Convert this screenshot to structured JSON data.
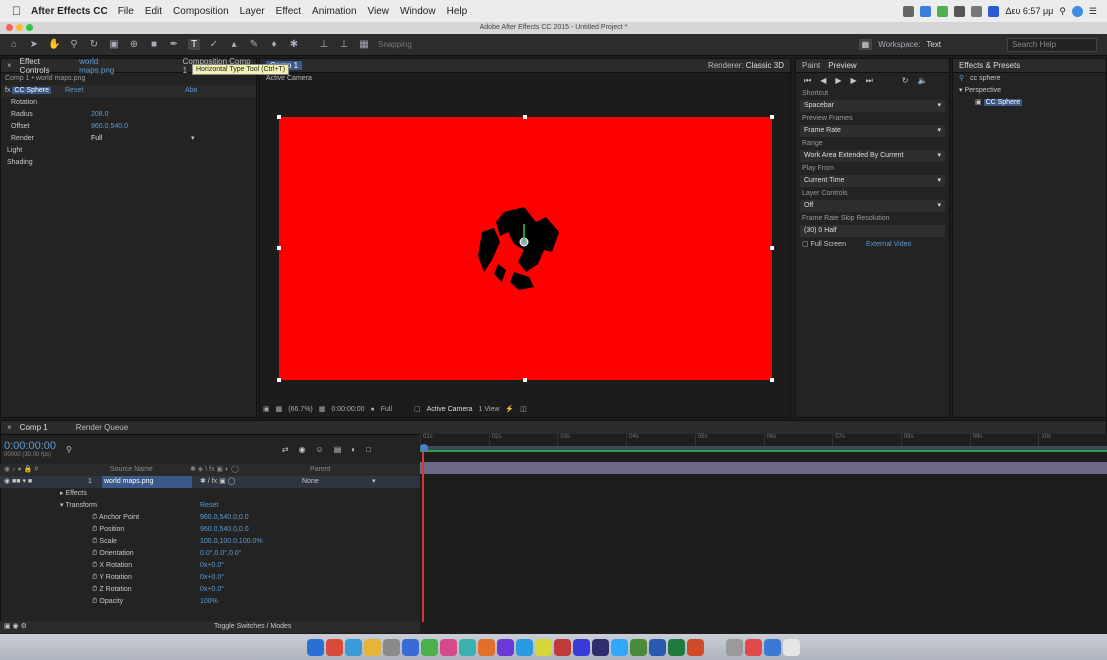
{
  "menubar": {
    "app_name": "After Effects CC",
    "items": [
      "File",
      "Edit",
      "Composition",
      "Layer",
      "Effect",
      "Animation",
      "View",
      "Window",
      "Help"
    ],
    "clock": "Δευ 6:57 μμ"
  },
  "window_title": "Adobe After Effects CC 2015 - Untitled Project *",
  "toolbar": {
    "snapping": "Snapping",
    "workspace_label": "Workspace:",
    "workspace_value": "Text",
    "search_placeholder": "Search Help"
  },
  "tooltip": "Horizontal Type Tool (Ctrl+T)",
  "effect_controls": {
    "tab": "Effect Controls",
    "tab_file": "world maps.png",
    "tab_comp": "Composition Comp 1",
    "header": "Comp 1 • world maps.png",
    "effect_name": "CC Sphere",
    "reset": "Reset",
    "about": "Abo",
    "rows": [
      {
        "name": "Rotation",
        "value": ""
      },
      {
        "name": "Radius",
        "value": "208.0"
      },
      {
        "name": "Offset",
        "value": "960.0,540.0"
      },
      {
        "name": "Render",
        "value": "Full"
      },
      {
        "name": "Light",
        "value": ""
      },
      {
        "name": "Shading",
        "value": ""
      }
    ]
  },
  "viewer": {
    "comp_tab": "Comp 1",
    "renderer_label": "Renderer:",
    "renderer": "Classic 3D",
    "camera_label": "Active Camera",
    "zoom": "(66.7%)",
    "timecode": "0:00:00:00",
    "quality": "Full",
    "camera_select": "Active Camera",
    "views": "1 View",
    "canvas_color": "#ff0000"
  },
  "preview": {
    "tabs": [
      "Paint",
      "Preview"
    ],
    "shortcut_label": "Shortcut",
    "shortcut": "Spacebar",
    "preview_label": "Preview Frames",
    "preview_value": "Frame Rate",
    "range_label": "Range",
    "range_value": "Work Area Extended By Current",
    "play_label": "Play From",
    "play_value": "Current Time",
    "layer_label": "Layer Controls",
    "layer_value": "Off",
    "fr_label": "Frame Rate  Skip    Resolution",
    "fr_values": "(30)    0    Half",
    "full_screen": "Full Screen",
    "external": "External Video"
  },
  "effects_presets": {
    "tab": "Effects & Presets",
    "search": "cc sphere",
    "category": "Perspective",
    "item": "CC Sphere"
  },
  "timeline": {
    "comp_tab": "Comp 1",
    "render_queue": "Render Queue",
    "timecode": "0:00:00:00",
    "fps": "00000 (30.00 fps)",
    "col_source": "Source Name",
    "col_parent": "Parent",
    "layer_num": "1",
    "layer_name": "world maps.png",
    "parent": "None",
    "effects": "Effects",
    "transform": "Transform",
    "transform_reset": "Reset",
    "properties": [
      {
        "name": "Anchor Point",
        "value": "960.0,540.0,0.0"
      },
      {
        "name": "Position",
        "value": "960.0,540.0,0.0"
      },
      {
        "name": "Scale",
        "value": "100.0,100.0,100.0%"
      },
      {
        "name": "Orientation",
        "value": "0.0°,0.0°,0.0°"
      },
      {
        "name": "X Rotation",
        "value": "0x+0.0°"
      },
      {
        "name": "Y Rotation",
        "value": "0x+0.0°"
      },
      {
        "name": "Z Rotation",
        "value": "0x+0.0°"
      },
      {
        "name": "Opacity",
        "value": "100%"
      }
    ],
    "toggle": "Toggle Switches / Modes",
    "ruler": [
      "01s",
      "02s",
      "03s",
      "04s",
      "05s",
      "06s",
      "07s",
      "08s",
      "09s",
      "10s"
    ]
  }
}
